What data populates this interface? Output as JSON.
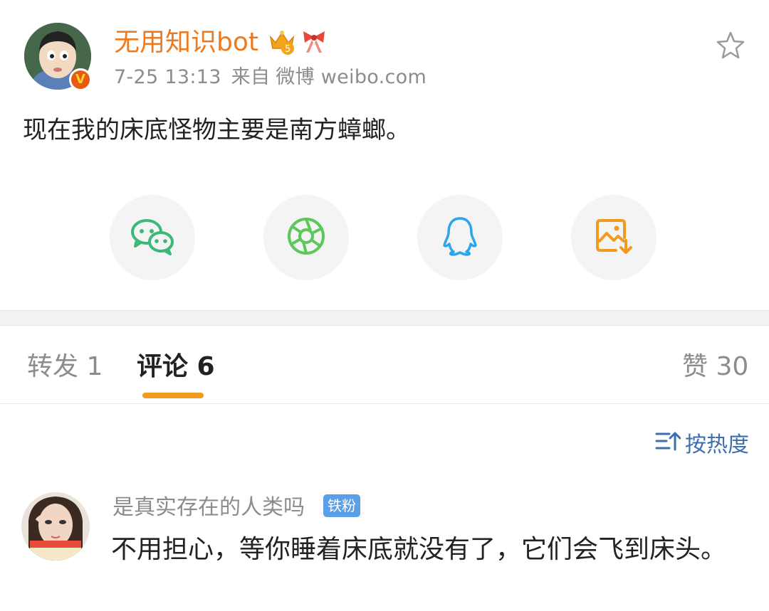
{
  "post": {
    "author": "无用知识bot",
    "timestamp": "7-25 13:13",
    "source_prefix": "来自",
    "source": "微博 weibo.com",
    "text": "现在我的床底怪物主要是南方蟑螂。",
    "verified_badge": "V",
    "level_badge": "5",
    "favorite_icon": "star-outline-icon"
  },
  "share": {
    "items": [
      {
        "icon": "wechat-icon",
        "color": "#3cb878"
      },
      {
        "icon": "moments-icon",
        "color": "#5cc85a"
      },
      {
        "icon": "qq-icon",
        "color": "#2ca6e8"
      },
      {
        "icon": "save-image-icon",
        "color": "#f39a1e"
      }
    ]
  },
  "tabs": {
    "repost": "转发 1",
    "comments": "评论 6",
    "likes": "赞 30",
    "accent": "#f09c1e"
  },
  "sort": {
    "label": "按热度",
    "color": "#3b6fb0"
  },
  "comments": [
    {
      "user": "是真实存在的人类吗",
      "badge": "铁粉",
      "text": "不用担心，等你睡着床底就没有了，它们会飞到床头。"
    }
  ]
}
